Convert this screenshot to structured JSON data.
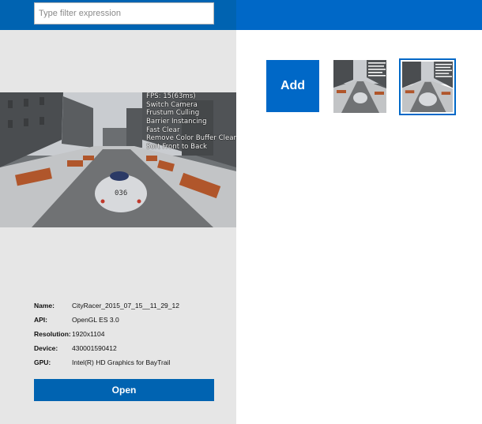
{
  "filter": {
    "placeholder": "Type filter expression",
    "value": ""
  },
  "preview_overlay": {
    "lines": [
      "FPS: 15(63ms)",
      "Switch Camera",
      "Frustum Culling",
      "Barrier Instancing",
      "Fast Clear",
      "Remove Color Buffer Clear",
      "Sort Front to Back"
    ],
    "car_number": "036"
  },
  "details": {
    "name_label": "Name:",
    "name_value": "CityRacer_2015_07_15__11_29_12",
    "api_label": "API:",
    "api_value": "OpenGL ES 3.0",
    "resolution_label": "Resolution:",
    "resolution_value": "1920x1104",
    "device_label": "Device:",
    "device_value": "430001590412",
    "gpu_label": "GPU:",
    "gpu_value": "Intel(R) HD Graphics for BayTrail"
  },
  "open_label": "Open",
  "add_label": "Add",
  "colors": {
    "accent": "#0068c7",
    "left_header": "#0063b1",
    "left_pane_bg": "#e6e6e6"
  }
}
